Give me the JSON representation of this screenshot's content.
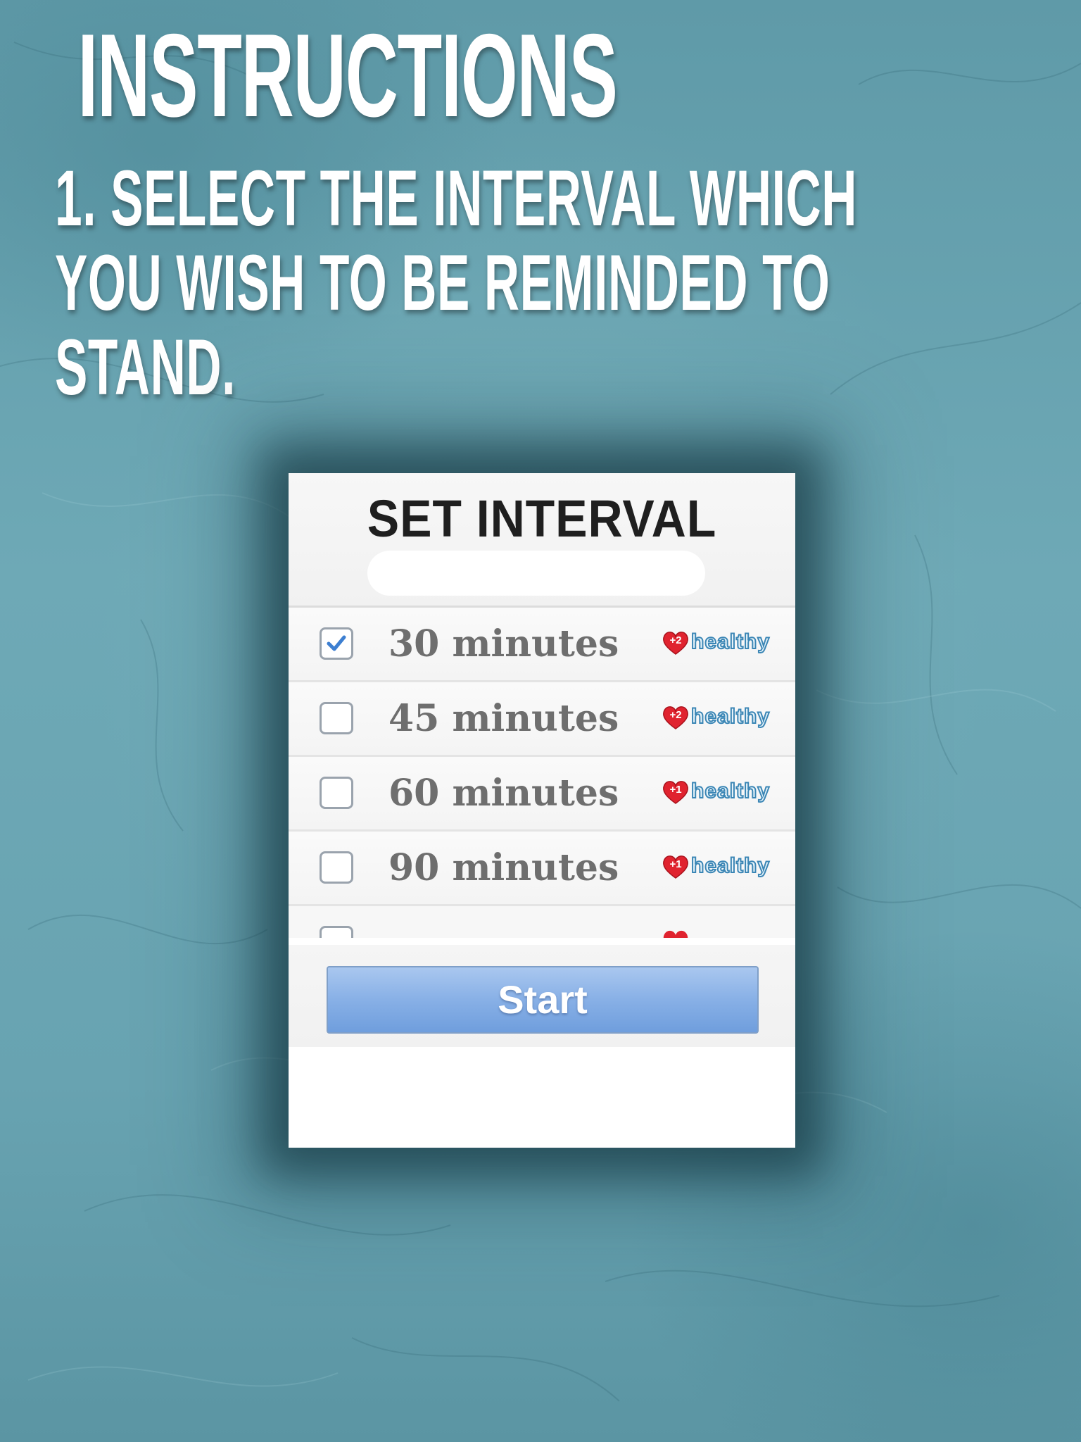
{
  "page": {
    "heading": "INSTRUCTIONS",
    "instruction_lines": [
      "1. SELECT THE INTERVAL WHICH",
      "YOU WISH TO BE REMINDED TO",
      "STAND."
    ]
  },
  "panel": {
    "title": "SET INTERVAL",
    "options": [
      {
        "label": "30 minutes",
        "checked": true,
        "badge_points": "+2",
        "badge_word": "healthy"
      },
      {
        "label": "45 minutes",
        "checked": false,
        "badge_points": "+2",
        "badge_word": "healthy"
      },
      {
        "label": "60 minutes",
        "checked": false,
        "badge_points": "+1",
        "badge_word": "healthy"
      },
      {
        "label": "90 minutes",
        "checked": false,
        "badge_points": "+1",
        "badge_word": "healthy"
      }
    ],
    "start_label": "Start"
  },
  "colors": {
    "background": "#6aa3b0",
    "button": "#88b0e6",
    "heart": "#e0232f",
    "check": "#3d7fd1"
  }
}
